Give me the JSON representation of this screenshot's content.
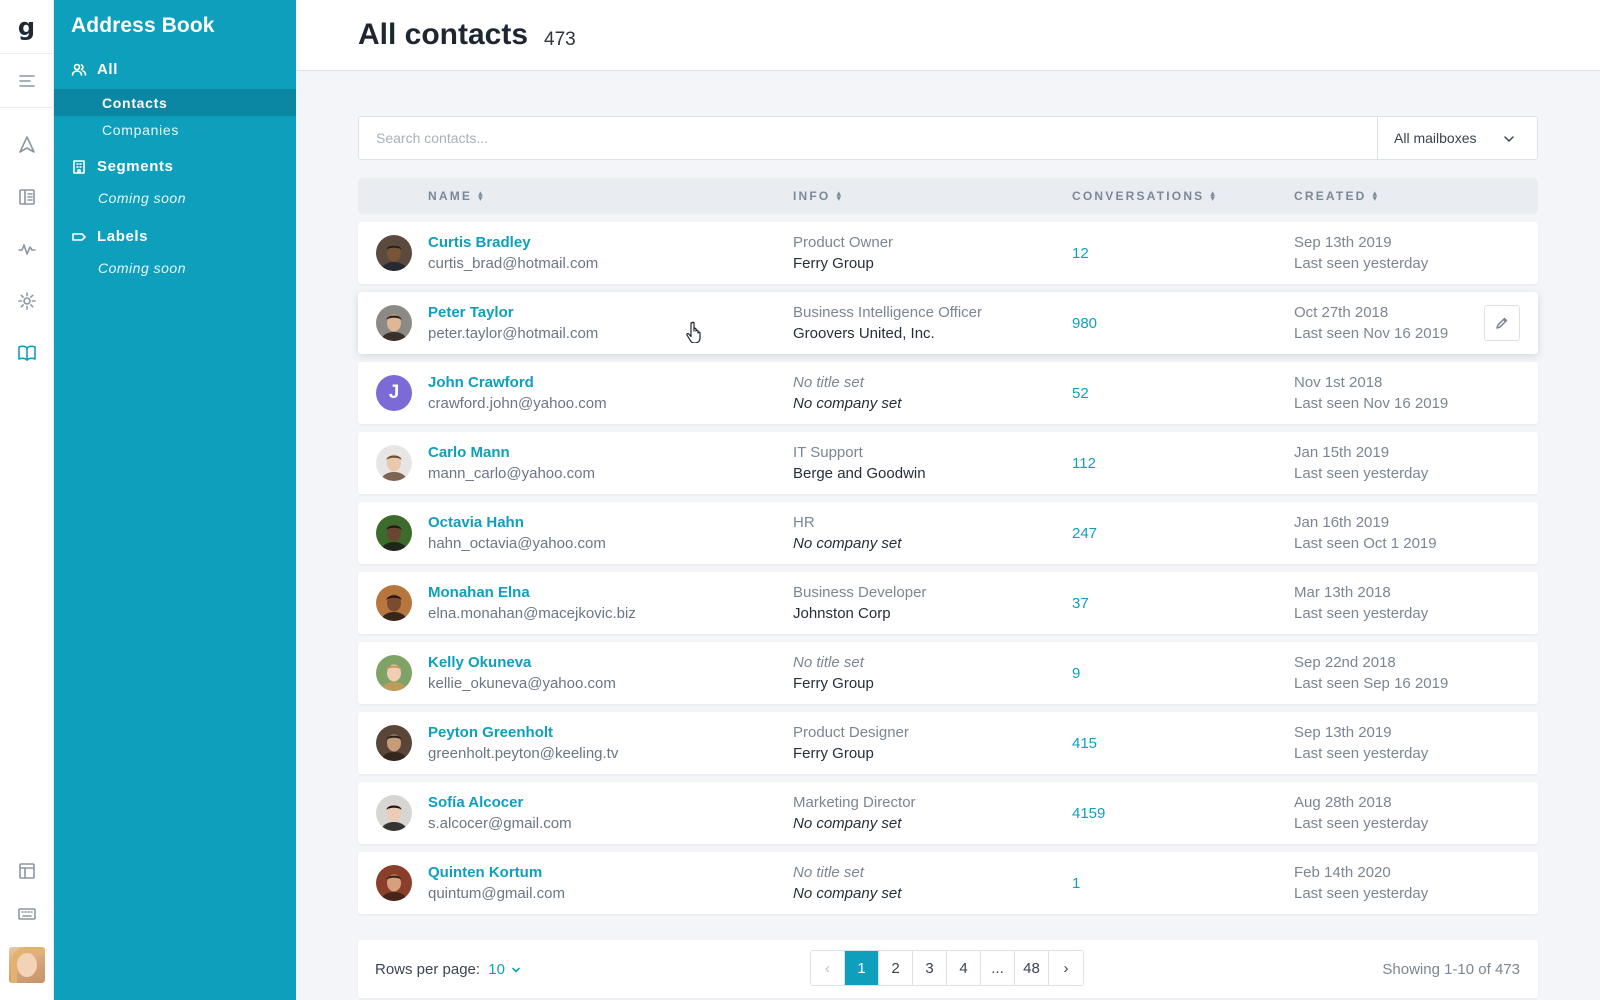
{
  "rail": {
    "logo": "g",
    "items": [
      {
        "name": "menu-icon"
      },
      {
        "name": "send-icon"
      },
      {
        "name": "book-icon"
      },
      {
        "name": "activity-icon"
      },
      {
        "name": "gear-icon"
      },
      {
        "name": "address-book-icon",
        "active": true
      },
      {
        "name": "table-icon"
      },
      {
        "name": "keyboard-icon"
      }
    ]
  },
  "sidebar": {
    "title": "Address Book",
    "all_label": "All",
    "items": [
      {
        "label": "Contacts",
        "active": true
      },
      {
        "label": "Companies"
      }
    ],
    "segments_label": "Segments",
    "segments_note": "Coming soon",
    "labels_label": "Labels",
    "labels_note": "Coming soon"
  },
  "header": {
    "title": "All contacts",
    "count": "473"
  },
  "search": {
    "placeholder": "Search contacts...",
    "mailbox": "All mailboxes"
  },
  "table": {
    "columns": [
      "NAME",
      "INFO",
      "CONVERSATIONS",
      "CREATED"
    ],
    "rows": [
      {
        "name": "Curtis Bradley",
        "email": "curtis_brad@hotmail.com",
        "title": "Product Owner",
        "company": "Ferry Group",
        "title_italic": false,
        "company_italic": false,
        "conversations": "12",
        "created": "Sep 13th 2019",
        "seen": "Last seen yesterday",
        "avatar": {
          "bg": "#5b4a3d",
          "skin": "#7a5436",
          "hat": "#1d2230"
        }
      },
      {
        "name": "Peter Taylor",
        "email": "peter.taylor@hotmail.com",
        "title": "Business Intelligence Officer",
        "company": "Groovers United, Inc.",
        "title_italic": false,
        "company_italic": false,
        "conversations": "980",
        "created": "Oct 27th 2018",
        "seen": "Last seen Nov 16 2019",
        "avatar": {
          "bg": "#8d8a86",
          "skin": "#e0b694",
          "hat": "#2c2019"
        }
      },
      {
        "name": "John Crawford",
        "email": "crawford.john@yahoo.com",
        "title": "No title set",
        "company": "No company set",
        "title_italic": true,
        "company_italic": true,
        "conversations": "52",
        "created": "Nov 1st 2018",
        "seen": "Last seen Nov 16 2019",
        "initial": "J"
      },
      {
        "name": "Carlo Mann",
        "email": "mann_carlo@yahoo.com",
        "title": "IT Support",
        "company": "Berge and Goodwin",
        "title_italic": false,
        "company_italic": false,
        "conversations": "112",
        "created": "Jan 15th 2019",
        "seen": "Last seen yesterday",
        "avatar": {
          "bg": "#e7e6e4",
          "skin": "#e9c8ad",
          "hat": "#6b4d38"
        }
      },
      {
        "name": "Octavia Hahn",
        "email": "hahn_octavia@yahoo.com",
        "title": "HR",
        "company": "No company set",
        "title_italic": false,
        "company_italic": true,
        "conversations": "247",
        "created": "Jan 16th 2019",
        "seen": "Last seen Oct 1 2019",
        "avatar": {
          "bg": "#3d6b2c",
          "skin": "#6a4632",
          "hat": "#1c1a17"
        }
      },
      {
        "name": "Monahan Elna",
        "email": "elna.monahan@macejkovic.biz",
        "title": "Business Developer",
        "company": "Johnston Corp",
        "title_italic": false,
        "company_italic": false,
        "conversations": "37",
        "created": "Mar 13th 2018",
        "seen": "Last seen yesterday",
        "avatar": {
          "bg": "#b6763e",
          "skin": "#7b4b2f",
          "hat": "#231913"
        }
      },
      {
        "name": "Kelly Okuneva",
        "email": "kellie_okuneva@yahoo.com",
        "title": "No title set",
        "company": "Ferry Group",
        "title_italic": true,
        "company_italic": false,
        "conversations": "9",
        "created": "Sep 22nd 2018",
        "seen": "Last seen Sep 16 2019",
        "avatar": {
          "bg": "#7fa266",
          "skin": "#f0cdb3",
          "hat": "#c9995c"
        }
      },
      {
        "name": "Peyton Greenholt",
        "email": "greenholt.peyton@keeling.tv",
        "title": "Product Designer",
        "company": "Ferry Group",
        "title_italic": false,
        "company_italic": false,
        "conversations": "415",
        "created": "Sep 13th 2019",
        "seen": "Last seen yesterday",
        "avatar": {
          "bg": "#5a4638",
          "skin": "#c79a78",
          "hat": "#2b211b"
        }
      },
      {
        "name": "Sofía Alcocer",
        "email": "s.alcocer@gmail.com",
        "title": "Marketing Director",
        "company": "No company set",
        "title_italic": false,
        "company_italic": true,
        "conversations": "4159",
        "created": "Aug 28th 2018",
        "seen": "Last seen yesterday",
        "avatar": {
          "bg": "#d8d6d3",
          "skin": "#ecccb4",
          "hat": "#1b1716"
        }
      },
      {
        "name": "Quinten Kortum",
        "email": "quintum@gmail.com",
        "title": "No title set",
        "company": "No company set",
        "title_italic": true,
        "company_italic": true,
        "conversations": "1",
        "created": "Feb 14th 2020",
        "seen": "Last seen yesterday",
        "avatar": {
          "bg": "#8a3f2a",
          "skin": "#d7a07c",
          "hat": "#3a2217"
        }
      }
    ]
  },
  "pagination": {
    "rows_label": "Rows per page:",
    "rows_value": "10",
    "prev": "‹",
    "pages": [
      "1",
      "2",
      "3",
      "4",
      "...",
      "48"
    ],
    "active_page": "1",
    "next": "›",
    "showing": "Showing 1-10 of 473"
  }
}
